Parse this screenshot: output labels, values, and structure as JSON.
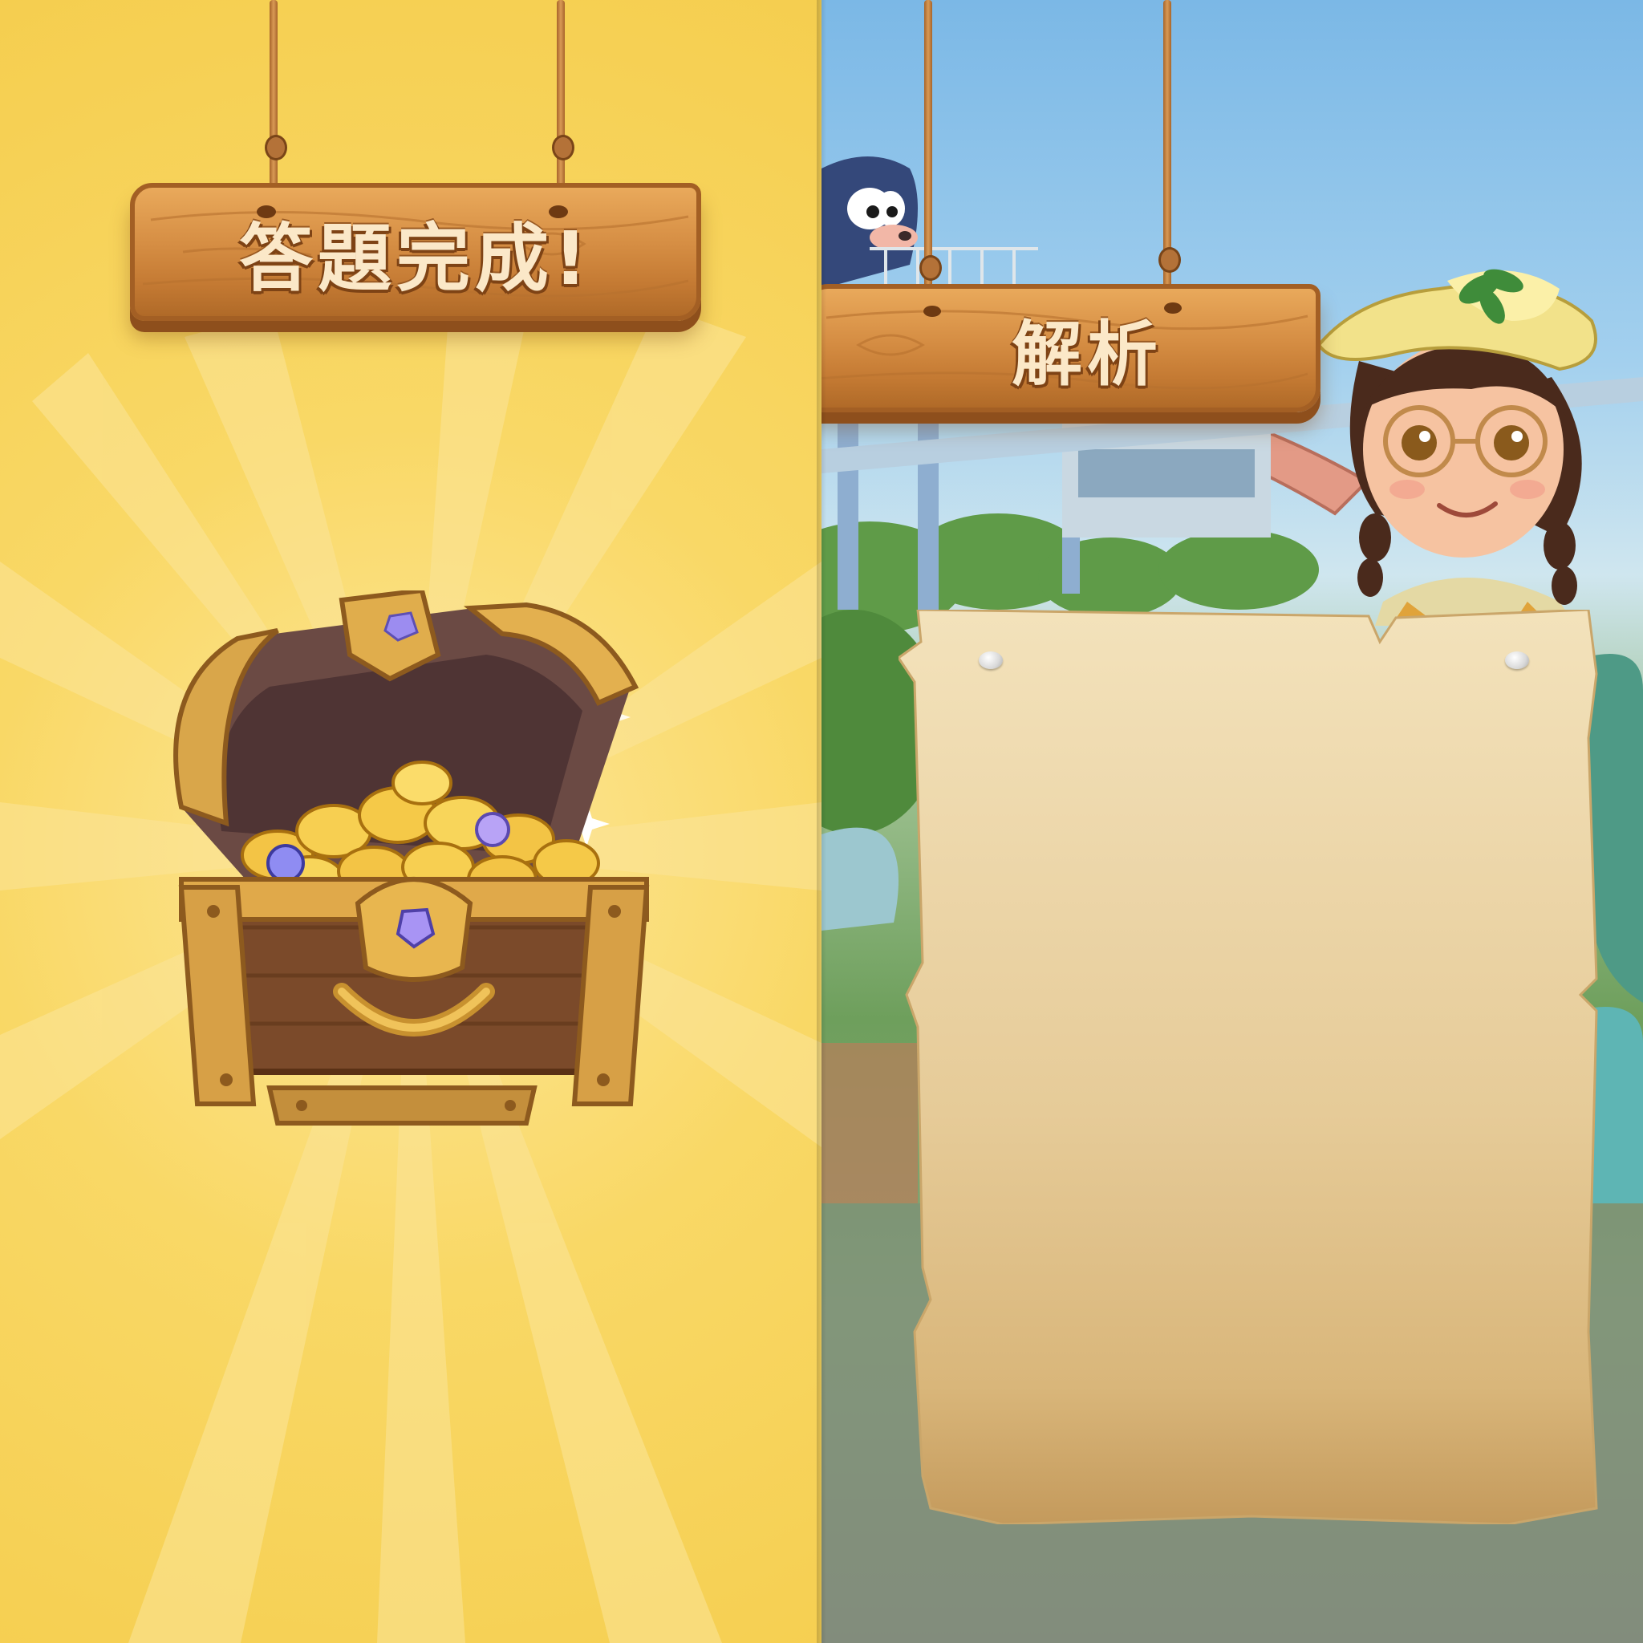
{
  "left_screen": {
    "title": "答題完成!",
    "illustration_icon": "treasure-chest-icon"
  },
  "right_screen": {
    "title": "解析",
    "character_icon": "explorer-girl-icon",
    "mascot_icon": "mole-mascot-icon",
    "panel": "blank-parchment-scroll"
  },
  "colors": {
    "left_background": "#f5ce4f",
    "wood_sign": "#d58d43",
    "sign_text": "#fbe8c8",
    "parchment": "#edd9ad"
  }
}
